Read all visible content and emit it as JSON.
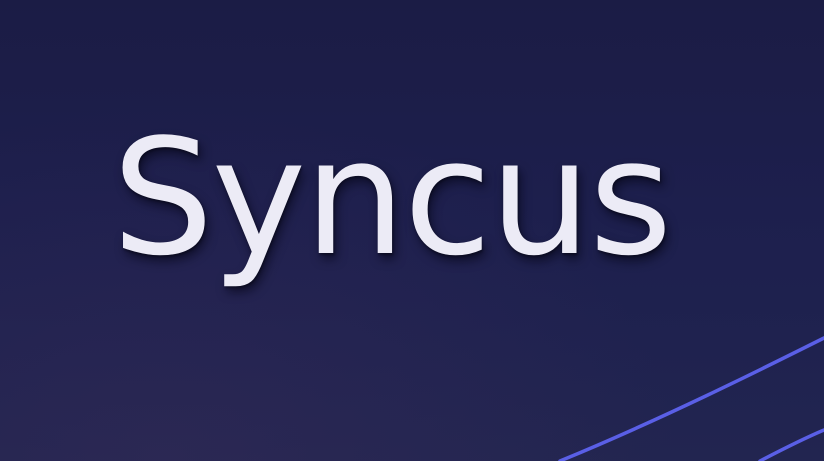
{
  "brand": {
    "name": "Syncus"
  },
  "colors": {
    "background": "#1d1f4d",
    "text": "#ecebf6",
    "accent_line": "#5a5fe6"
  },
  "icons": {
    "decoration": "curved-lines-decoration"
  }
}
